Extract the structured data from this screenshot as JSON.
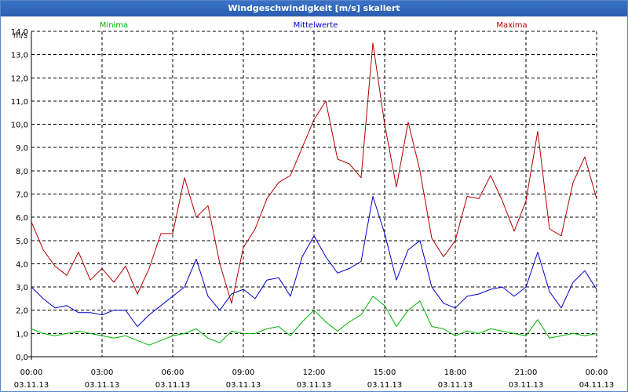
{
  "window": {
    "title": "Windgeschwindigkeit [m/s] skaliert"
  },
  "chart_data": {
    "type": "line",
    "title": "Windgeschwindigkeit [m/s] skaliert",
    "ylabel": "m/s",
    "xlabel": "",
    "ylim": [
      0,
      14.0
    ],
    "xlim": [
      "03.11.13 00:00",
      "04.11.13 00:00"
    ],
    "grid": true,
    "legend_placement": "top",
    "y_ticks": [
      "0,0",
      "1,0",
      "2,0",
      "3,0",
      "4,0",
      "5,0",
      "6,0",
      "7,0",
      "8,0",
      "9,0",
      "10,0",
      "11,0",
      "12,0",
      "13,0",
      "14,0"
    ],
    "x_ticks": [
      {
        "time": "00:00",
        "date": "03.11.13"
      },
      {
        "time": "03:00",
        "date": "03.11.13"
      },
      {
        "time": "06:00",
        "date": "03.11.13"
      },
      {
        "time": "09:00",
        "date": "03.11.13"
      },
      {
        "time": "12:00",
        "date": "03.11.13"
      },
      {
        "time": "15:00",
        "date": "03.11.13"
      },
      {
        "time": "18:00",
        "date": "03.11.13"
      },
      {
        "time": "21:00",
        "date": "03.11.13"
      },
      {
        "time": "00:00",
        "date": "04.11.13"
      }
    ],
    "x_hours": [
      0,
      0.5,
      1,
      1.5,
      2,
      2.5,
      3,
      3.5,
      4,
      4.5,
      5,
      5.5,
      6,
      6.5,
      7,
      7.5,
      8,
      8.5,
      9,
      9.5,
      10,
      10.5,
      11,
      11.5,
      12,
      12.5,
      13,
      13.5,
      14,
      14.5,
      15,
      15.5,
      16,
      16.5,
      17,
      17.5,
      18,
      18.5,
      19,
      19.5,
      20,
      20.5,
      21,
      21.5,
      22,
      22.5,
      23,
      23.5,
      24
    ],
    "series": [
      {
        "name": "Minima",
        "color": "#00b400",
        "values": [
          1.2,
          1.0,
          0.9,
          1.0,
          1.1,
          1.0,
          0.9,
          0.8,
          0.9,
          0.7,
          0.5,
          0.7,
          0.9,
          1.0,
          1.2,
          0.8,
          0.6,
          1.1,
          1.0,
          1.0,
          1.2,
          1.3,
          0.9,
          1.5,
          2.0,
          1.5,
          1.1,
          1.5,
          1.8,
          2.6,
          2.2,
          1.3,
          2.0,
          2.4,
          1.3,
          1.2,
          0.9,
          1.1,
          1.0,
          1.2,
          1.1,
          1.0,
          0.9,
          1.6,
          0.8,
          0.9,
          1.0,
          0.9,
          1.0
        ]
      },
      {
        "name": "Mittelwerte",
        "color": "#0000c8",
        "values": [
          3.0,
          2.5,
          2.1,
          2.2,
          1.9,
          1.9,
          1.8,
          2.0,
          2.0,
          1.3,
          1.8,
          2.2,
          2.6,
          3.0,
          4.2,
          2.6,
          2.0,
          2.7,
          2.9,
          2.5,
          3.3,
          3.4,
          2.6,
          4.3,
          5.2,
          4.3,
          3.6,
          3.8,
          4.1,
          6.9,
          5.3,
          3.3,
          4.6,
          5.0,
          3.0,
          2.3,
          2.1,
          2.6,
          2.7,
          2.9,
          3.0,
          2.6,
          3.0,
          4.5,
          2.8,
          2.1,
          3.2,
          3.7,
          2.9
        ]
      },
      {
        "name": "Maxima",
        "color": "#b40000",
        "values": [
          5.8,
          4.6,
          3.9,
          3.5,
          4.5,
          3.3,
          3.8,
          3.2,
          3.9,
          2.7,
          3.8,
          5.3,
          5.3,
          7.7,
          6.0,
          6.5,
          4.0,
          2.3,
          4.7,
          5.5,
          6.8,
          7.5,
          7.8,
          9.0,
          10.2,
          11.0,
          8.5,
          8.3,
          7.7,
          13.5,
          10.0,
          7.3,
          10.1,
          8.0,
          5.1,
          4.3,
          5.0,
          6.9,
          6.8,
          7.8,
          6.7,
          5.4,
          6.7,
          9.7,
          5.5,
          5.2,
          7.5,
          8.6,
          6.8
        ]
      }
    ]
  }
}
